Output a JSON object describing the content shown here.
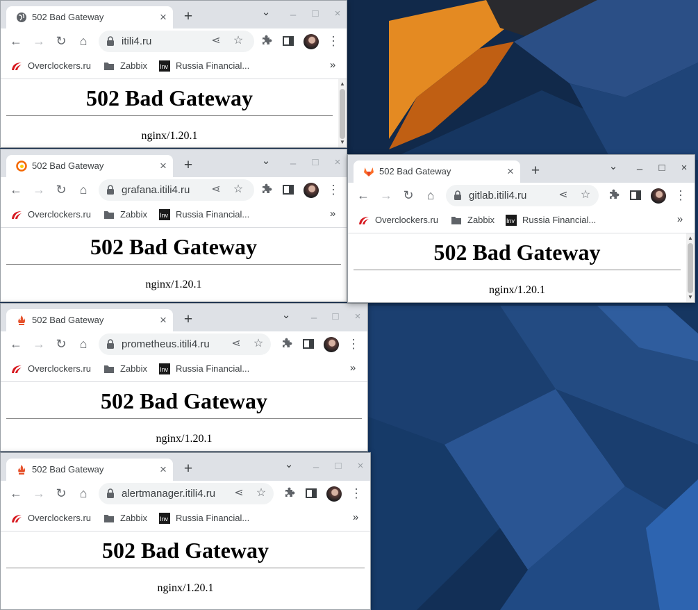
{
  "bookmarks": {
    "items": [
      {
        "label": "Overclockers.ru",
        "icon": "overclockers-icon"
      },
      {
        "label": "Zabbix",
        "icon": "folder-icon"
      },
      {
        "label": "Russia Financial...",
        "icon": "investing-icon"
      }
    ],
    "more": "»"
  },
  "page": {
    "heading": "502 Bad Gateway",
    "server": "nginx/1.20.1"
  },
  "windows": [
    {
      "id": "itili4",
      "tab_title": "502 Bad Gateway",
      "favicon": "globe-icon",
      "url": "itili4.ru",
      "scrollbar": true
    },
    {
      "id": "grafana",
      "tab_title": "502 Bad Gateway",
      "favicon": "grafana-icon",
      "url": "grafana.itili4.ru",
      "scrollbar": false
    },
    {
      "id": "gitlab",
      "tab_title": "502 Bad Gateway",
      "favicon": "gitlab-icon",
      "url": "gitlab.itili4.ru",
      "scrollbar": true
    },
    {
      "id": "prometheus",
      "tab_title": "502 Bad Gateway",
      "favicon": "prometheus-icon",
      "url": "prometheus.itili4.ru",
      "scrollbar": false
    },
    {
      "id": "alertmanager",
      "tab_title": "502 Bad Gateway",
      "favicon": "alertmanager-icon",
      "url": "alertmanager.itili4.ru",
      "scrollbar": false
    }
  ],
  "icons": {
    "new_tab": "+",
    "tab_close": "×",
    "back": "←",
    "forward": "→",
    "reload": "↻",
    "home": "⌂",
    "share": "⋖",
    "star": "☆",
    "extensions": "puzzle-icon",
    "side_panel": "side-panel-icon",
    "menu": "⋮",
    "tab_search": "⌄",
    "minimize": "–",
    "maximize": "□",
    "close": "×"
  },
  "colors": {
    "titlebar": "#dee1e6",
    "omnibox": "#f1f3f4",
    "desktop_blue": "#15345e",
    "desktop_orange": "#e0841f"
  }
}
